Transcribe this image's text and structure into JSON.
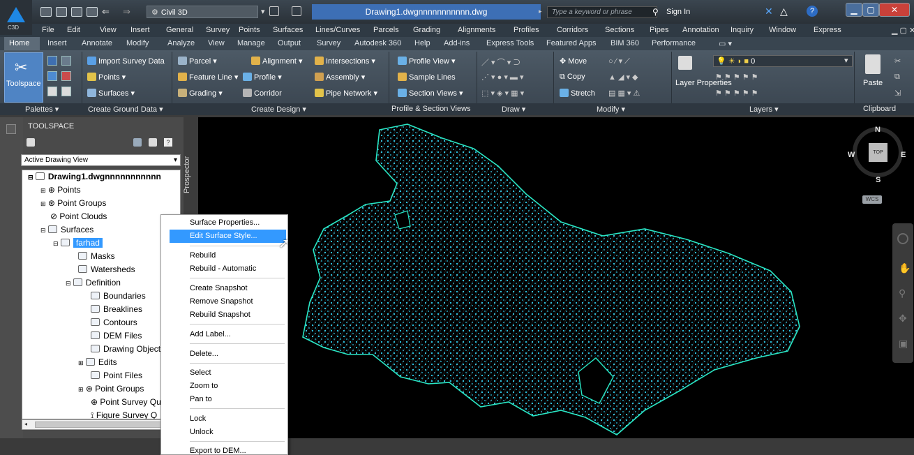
{
  "app": {
    "logo_label": "C3D",
    "workspace": "Civil 3D",
    "doc_title": "Drawing1.dwgnnnnnnnnnnn.dwg",
    "search_placeholder": "Type a keyword or phrase",
    "sign_in": "Sign In"
  },
  "menubar": [
    "File",
    "Edit",
    "View",
    "Insert",
    "General",
    "Survey",
    "Points",
    "Surfaces",
    "Lines/Curves",
    "Parcels",
    "Grading",
    "Alignments",
    "Profiles",
    "Corridors",
    "Sections",
    "Pipes",
    "Annotation",
    "Inquiry",
    "Window",
    "Express"
  ],
  "tabs": [
    "Home",
    "Insert",
    "Annotate",
    "Modify",
    "Analyze",
    "View",
    "Manage",
    "Output",
    "Survey",
    "Autodesk 360",
    "Help",
    "Add-ins",
    "Express Tools",
    "Featured Apps",
    "BIM 360",
    "Performance"
  ],
  "ribbon": {
    "toolspace": "Toolspace",
    "import_survey": "Import Survey Data",
    "points": "Points",
    "surfaces": "Surfaces",
    "parcel": "Parcel",
    "feature_line": "Feature Line",
    "grading": "Grading",
    "alignment": "Alignment",
    "profile": "Profile",
    "corridor": "Corridor",
    "intersections": "Intersections",
    "assembly": "Assembly",
    "pipe_network": "Pipe Network",
    "profile_view": "Profile View",
    "sample_lines": "Sample Lines",
    "section_views": "Section Views",
    "move": "Move",
    "copy": "Copy",
    "stretch": "Stretch",
    "layer_properties": "Layer Properties",
    "layer_value": "0",
    "paste": "Paste"
  },
  "panels": [
    "Palettes",
    "Create Ground Data",
    "Create Design",
    "Profile & Section Views",
    "Draw",
    "Modify",
    "Layers",
    "Clipboard"
  ],
  "toolspace": {
    "title": "TOOLSPACE",
    "view": "Active Drawing View",
    "prospector": "Prospector",
    "tree": [
      "Drawing1.dwgnnnnnnnnnnn",
      "Points",
      "Point Groups",
      "Point Clouds",
      "Surfaces",
      "farhad",
      "Masks",
      "Watersheds",
      "Definition",
      "Boundaries",
      "Breaklines",
      "Contours",
      "DEM Files",
      "Drawing Objects",
      "Edits",
      "Point Files",
      "Point Groups",
      "Point Survey Qu",
      "Figure Survey Q"
    ]
  },
  "context_menu": [
    "Surface Properties...",
    "Edit Surface Style...",
    "Rebuild",
    "Rebuild - Automatic",
    "Create Snapshot",
    "Remove Snapshot",
    "Rebuild Snapshot",
    "Add Label...",
    "Delete...",
    "Select",
    "Zoom to",
    "Pan to",
    "Lock",
    "Unlock",
    "Export to DEM..."
  ],
  "viewcube": {
    "n": "N",
    "s": "S",
    "e": "E",
    "w": "W",
    "top": "TOP",
    "wcs": "WCS"
  },
  "colors": {
    "accent": "#3399ff",
    "surface_outline": "#27e6c4",
    "points": "#2ed3f5"
  }
}
